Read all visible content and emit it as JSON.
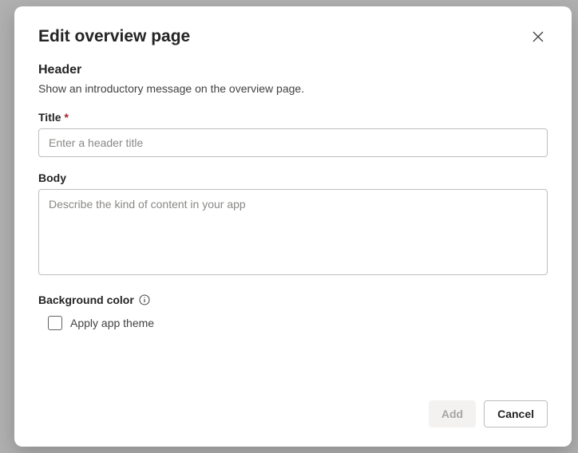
{
  "dialog": {
    "title": "Edit overview page",
    "header": {
      "section_title": "Header",
      "description": "Show an introductory message on the overview page."
    },
    "fields": {
      "title": {
        "label": "Title",
        "required": "*",
        "placeholder": "Enter a header title",
        "value": ""
      },
      "body": {
        "label": "Body",
        "placeholder": "Describe the kind of content in your app",
        "value": ""
      },
      "background_color": {
        "label": "Background color",
        "checkbox_label": "Apply app theme",
        "checked": false
      }
    },
    "actions": {
      "add": "Add",
      "cancel": "Cancel"
    }
  }
}
